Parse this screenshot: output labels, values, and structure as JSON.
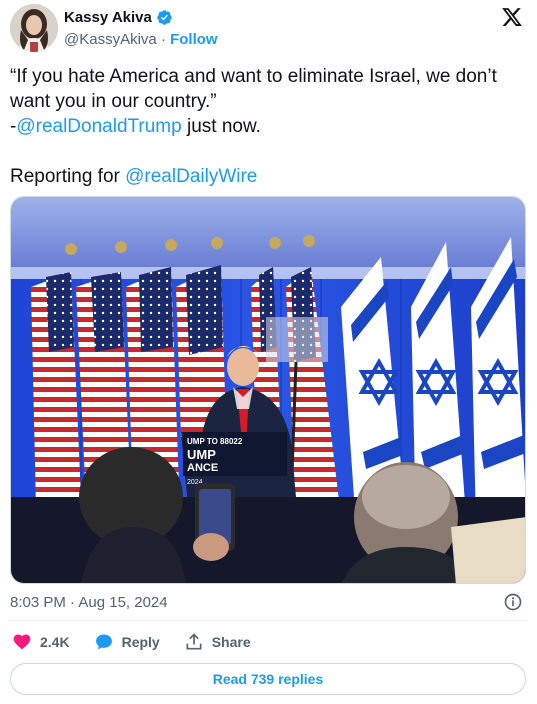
{
  "author": {
    "name": "Kassy Akiva",
    "handle": "@KassyAkiva",
    "separator": "·",
    "follow_label": "Follow"
  },
  "tweet": {
    "line1": "“If you hate America and want to eliminate Israel, we don’t want you in our country.”",
    "line2_prefix": "-",
    "line2_mention": "@realDonaldTrump",
    "line2_suffix": " just now.",
    "line3_prefix": "Reporting for ",
    "line3_mention": "@realDailyWire"
  },
  "photo": {
    "podium_line1": "UMP TO 88022",
    "podium_line2": "UMP",
    "podium_line3": "ANCE",
    "podium_line4": "2024",
    "description_icon": "photo"
  },
  "meta": {
    "timestamp": "8:03 PM · Aug 15, 2024"
  },
  "actions": {
    "like_count": "2.4K",
    "reply_label": "Reply",
    "share_label": "Share"
  },
  "read_replies_label": "Read 739 replies",
  "colors": {
    "accent": "#1d9bf0",
    "like": "#f91880",
    "muted": "#536471"
  }
}
